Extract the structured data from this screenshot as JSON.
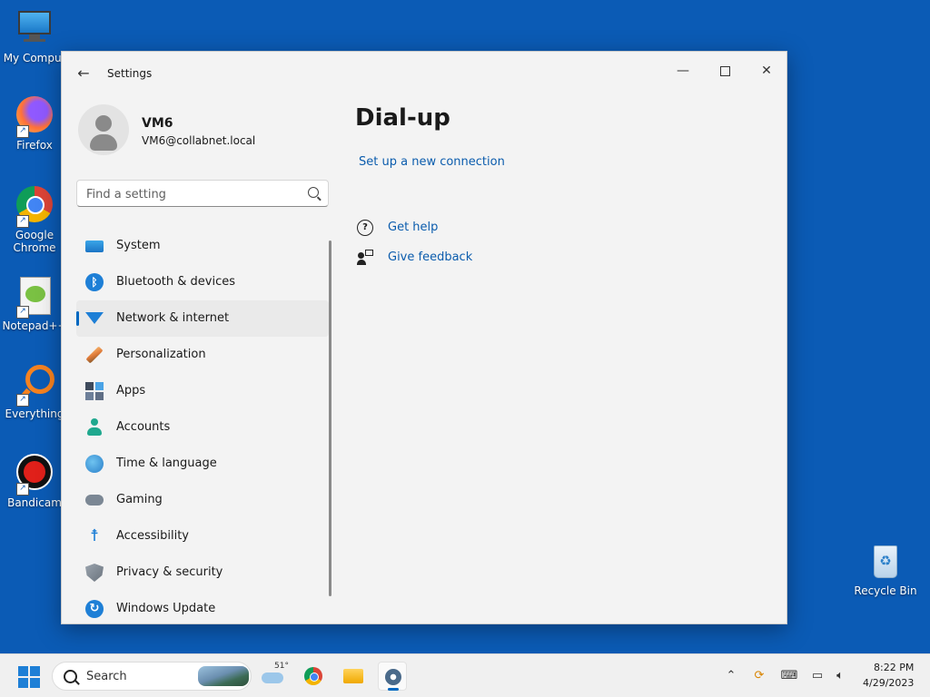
{
  "desktop": {
    "icons": [
      {
        "label": "My Comput"
      },
      {
        "label": "Firefox"
      },
      {
        "label": "Google Chrome"
      },
      {
        "label": "Notepad++"
      },
      {
        "label": "Everything"
      },
      {
        "label": "Bandicam"
      },
      {
        "label": "Recycle Bin"
      }
    ]
  },
  "window": {
    "title": "Settings",
    "controls": {
      "minimize": "—",
      "close": "✕"
    },
    "back_glyph": "←"
  },
  "profile": {
    "name": "VM6",
    "email": "VM6@collabnet.local"
  },
  "search": {
    "placeholder": "Find a setting"
  },
  "nav": {
    "active": "Network & internet",
    "items": [
      {
        "label": "System",
        "icon": "monitor-icon"
      },
      {
        "label": "Bluetooth & devices",
        "icon": "bluetooth-icon"
      },
      {
        "label": "Network & internet",
        "icon": "wifi-icon"
      },
      {
        "label": "Personalization",
        "icon": "brush-icon"
      },
      {
        "label": "Apps",
        "icon": "apps-icon"
      },
      {
        "label": "Accounts",
        "icon": "person-icon"
      },
      {
        "label": "Time & language",
        "icon": "globe-clock-icon"
      },
      {
        "label": "Gaming",
        "icon": "gamepad-icon"
      },
      {
        "label": "Accessibility",
        "icon": "accessibility-icon"
      },
      {
        "label": "Privacy & security",
        "icon": "shield-icon"
      },
      {
        "label": "Windows Update",
        "icon": "update-icon"
      }
    ]
  },
  "content": {
    "title": "Dial-up",
    "setup_link": "Set up a new connection",
    "get_help": "Get help",
    "give_feedback": "Give feedback"
  },
  "taskbar": {
    "search_label": "Search",
    "weather_temp": "51°",
    "clock_time": "8:22 PM",
    "clock_date": "4/29/2023"
  },
  "colors": {
    "desktop": "#0b5bb5",
    "accent": "#0067c0",
    "link": "#0b5cad"
  }
}
